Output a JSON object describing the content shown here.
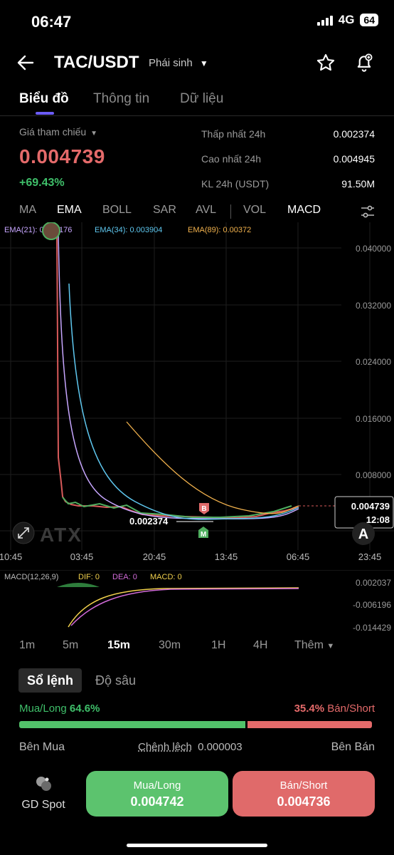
{
  "status": {
    "time": "06:47",
    "network": "4G",
    "battery": "64"
  },
  "header": {
    "pair": "TAC/USDT",
    "market_type": "Phái sinh",
    "back_icon": "arrow-left-icon",
    "fav_icon": "star-icon",
    "alert_icon": "bell-plus-icon"
  },
  "tabs": [
    "Biểu đồ",
    "Thông tin",
    "Dữ liệu"
  ],
  "price_block": {
    "ref_label": "Giá tham chiếu",
    "price": "0.004739",
    "change": "+69.43%",
    "stats": [
      {
        "label": "Thấp nhất 24h",
        "value": "0.002374"
      },
      {
        "label": "Cao nhất 24h",
        "value": "0.004945"
      },
      {
        "label": "KL 24h (USDT)",
        "value": "91.50M"
      }
    ]
  },
  "indicators": [
    "MA",
    "EMA",
    "BOLL",
    "SAR",
    "AVL",
    "VOL",
    "MACD"
  ],
  "chart": {
    "ema_legend": [
      {
        "text": "EMA(21): 0.004176",
        "color": "#c7a6ff"
      },
      {
        "text": "EMA(34): 0.003904",
        "color": "#5fc8f0"
      },
      {
        "text": "EMA(89): 0.00372",
        "color": "#f2b24d"
      }
    ],
    "y_ticks": [
      "0.040000",
      "0.032000",
      "0.024000",
      "0.016000",
      "0.008000"
    ],
    "x_ticks": [
      "10:45",
      "03:45",
      "20:45",
      "13:45",
      "06:45",
      "23:45"
    ],
    "current_price": "0.004739",
    "countdown": "12:08",
    "low_label": "0.002374",
    "marker_b": "B",
    "marker_m": "M",
    "watermark": "ATX",
    "a_button": "A",
    "fullscreen_icon": "expand-icon"
  },
  "macd": {
    "legend": "MACD(12,26,9)",
    "dif": "DIF: 0",
    "dea": "DEA: 0",
    "macd": "MACD: 0",
    "ticks": [
      "0.002037",
      "-0.006196",
      "-0.014429"
    ]
  },
  "timeframes": [
    "1m",
    "5m",
    "15m",
    "30m",
    "1H",
    "4H",
    "Thêm"
  ],
  "orderbook": {
    "tabs": [
      "Sổ lệnh",
      "Độ sâu"
    ],
    "long_label": "Mua/Long",
    "long_pct": "64.6%",
    "short_pct": "35.4%",
    "short_label": "Bán/Short",
    "long_ratio": 0.646,
    "buy_side": "Bên Mua",
    "spread_label": "Chênh lệch",
    "spread_value": "0.000003",
    "sell_side": "Bên Bán"
  },
  "bottom": {
    "spot_label": "GD Spot",
    "buy_label": "Mua/Long",
    "buy_price": "0.004742",
    "sell_label": "Bán/Short",
    "sell_price": "0.004736",
    "buy_color": "#5cc36e",
    "sell_color": "#e06a6a"
  }
}
